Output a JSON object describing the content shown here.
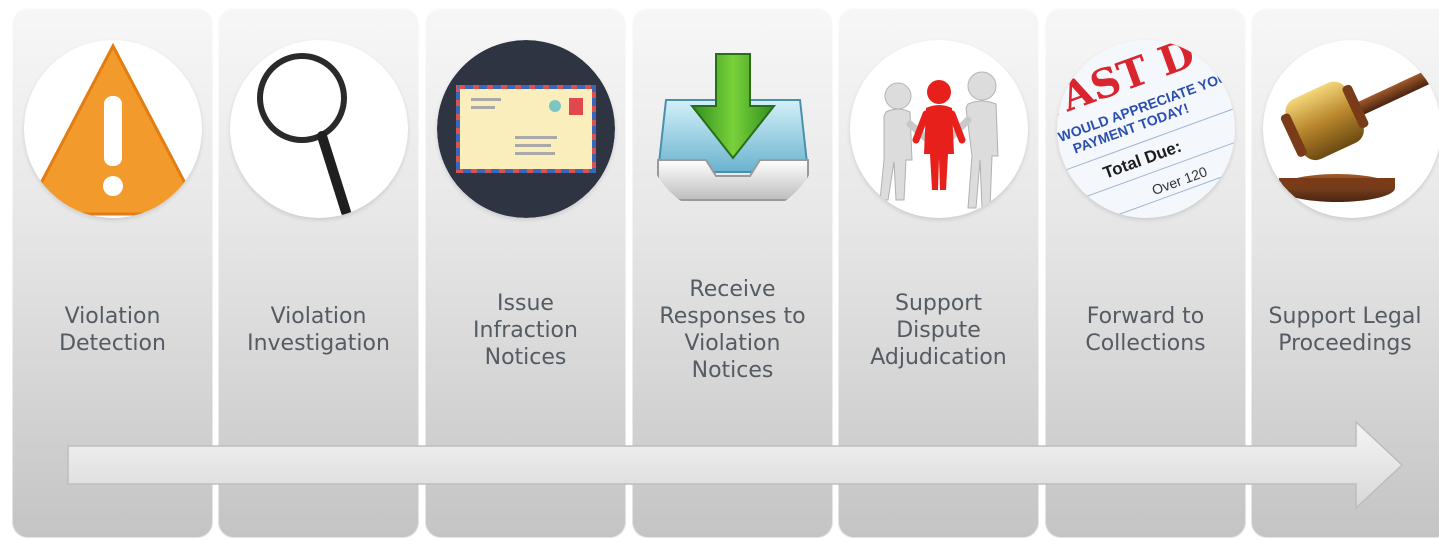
{
  "steps": [
    {
      "label": "Violation\nDetection",
      "icon": "warning-icon"
    },
    {
      "label": "Violation\nInvestigation",
      "icon": "magnifying-glass-icon"
    },
    {
      "label": "Issue\nInfraction\nNotices",
      "icon": "envelope-icon"
    },
    {
      "label": "Receive\nResponses to\nViolation\nNotices",
      "icon": "inbox-download-icon"
    },
    {
      "label": "Support\nDispute\nAdjudication",
      "icon": "dispute-figures-icon"
    },
    {
      "label": "Forward to\nCollections",
      "icon": "past-due-notice-icon"
    },
    {
      "label": "Support Legal\nProceedings",
      "icon": "gavel-icon"
    }
  ],
  "icon_text": {
    "past_due": "PAST DUE!",
    "appreciate": "WOULD APPRECIATE YOUR",
    "payment_today": "PAYMENT TODAY!",
    "total_due": "Total Due:",
    "over": "Over 120"
  },
  "colors": {
    "label_text": "#555b63",
    "warning": "#f39a2d",
    "envelope_bg": "#2e3442",
    "arrow_fill": "#e6e6e6"
  }
}
